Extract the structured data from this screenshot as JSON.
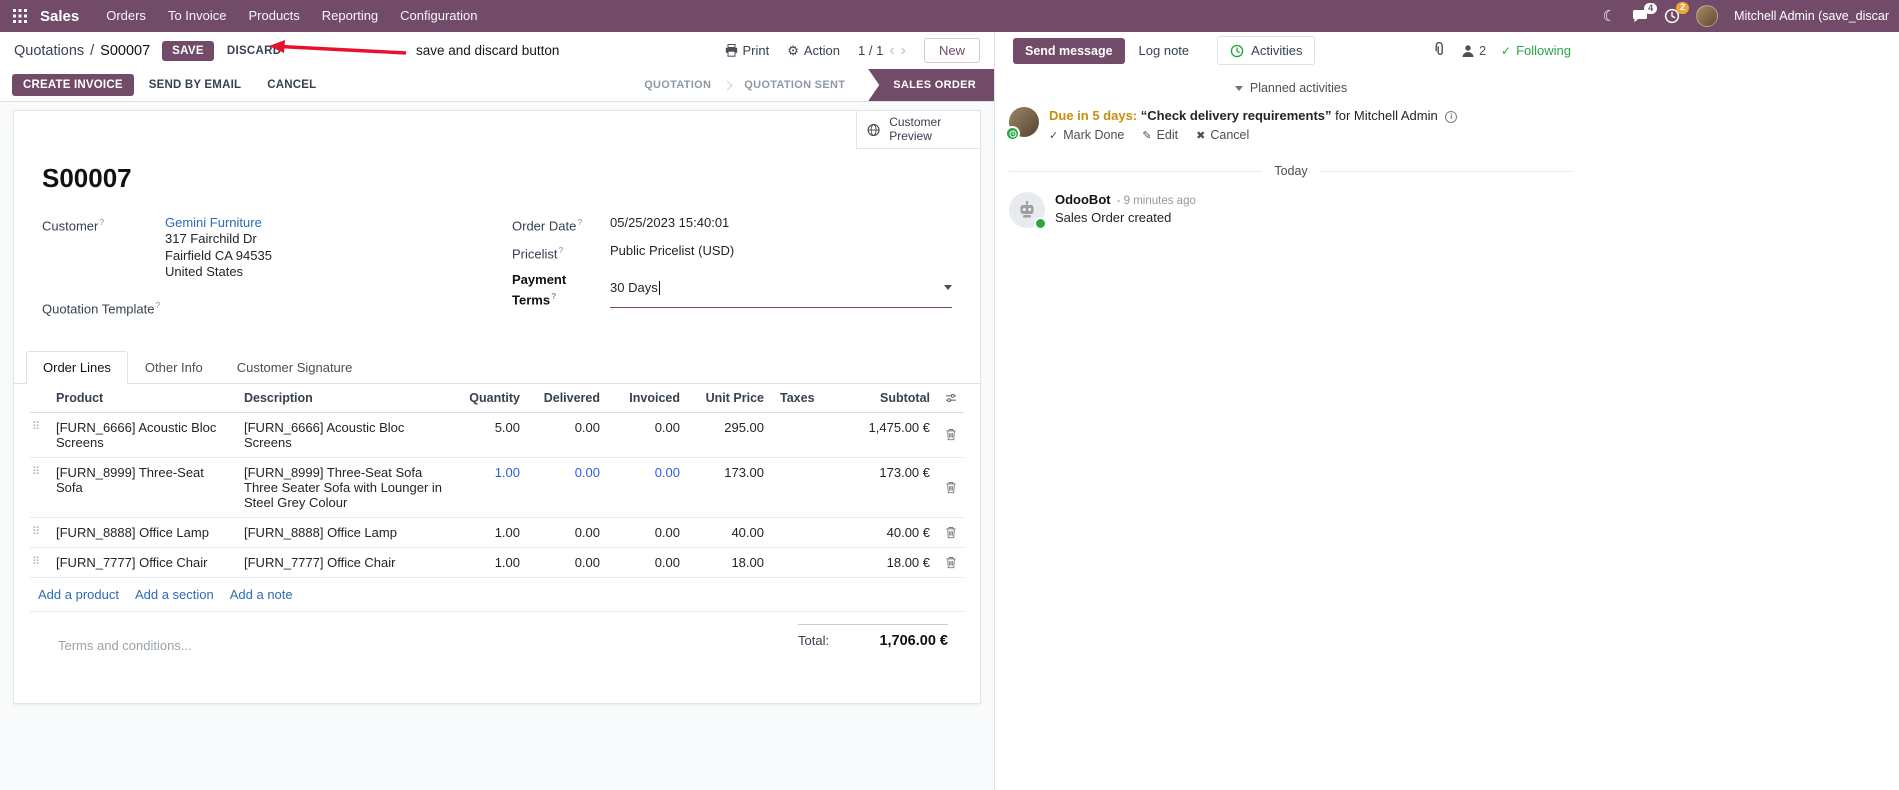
{
  "topbar": {
    "brand": "Sales",
    "menus": [
      "Orders",
      "To Invoice",
      "Products",
      "Reporting",
      "Configuration"
    ],
    "message_badge": "4",
    "activity_badge": "2",
    "user_name": "Mitchell Admin (save_discar"
  },
  "control_panel": {
    "breadcrumb_parent": "Quotations",
    "breadcrumb_separator": "/",
    "breadcrumb_current": "S00007",
    "save_label": "SAVE",
    "discard_label": "DISCARD",
    "annotation_text": "save and discard button",
    "print_label": "Print",
    "action_label": "Action",
    "pager": "1 / 1",
    "new_label": "New"
  },
  "status_row": {
    "create_invoice": "CREATE INVOICE",
    "send_by_email": "SEND BY EMAIL",
    "cancel": "CANCEL",
    "states": [
      {
        "label": "QUOTATION"
      },
      {
        "label": "QUOTATION SENT"
      },
      {
        "label": "SALES ORDER"
      }
    ]
  },
  "sheet": {
    "customer_preview": "Customer Preview",
    "title": "S00007",
    "customer": {
      "label": "Customer",
      "name": "Gemini Furniture",
      "address1": "317 Fairchild Dr",
      "address2": "Fairfield CA 94535",
      "address3": "United States"
    },
    "quotation_template_label": "Quotation Template",
    "order_date": {
      "label": "Order Date",
      "value": "05/25/2023 15:40:01"
    },
    "pricelist": {
      "label": "Pricelist",
      "value": "Public Pricelist (USD)"
    },
    "payment_terms": {
      "label": "Payment Terms",
      "value": "30 Days"
    },
    "tabs": [
      "Order Lines",
      "Other Info",
      "Customer Signature"
    ],
    "table": {
      "headers": {
        "product": "Product",
        "description": "Description",
        "quantity": "Quantity",
        "delivered": "Delivered",
        "invoiced": "Invoiced",
        "unit_price": "Unit Price",
        "taxes": "Taxes",
        "subtotal": "Subtotal"
      },
      "rows": [
        {
          "product": "[FURN_6666] Acoustic Bloc Screens",
          "description": "[FURN_6666] Acoustic Bloc Screens",
          "description2": "",
          "quantity": "5.00",
          "delivered": "0.00",
          "invoiced": "0.00",
          "unit_price": "295.00",
          "taxes": "",
          "subtotal": "1,475.00 €"
        },
        {
          "product": "[FURN_8999] Three-Seat Sofa",
          "description": "[FURN_8999] Three-Seat Sofa",
          "description2": "Three Seater Sofa with Lounger in Steel Grey Colour",
          "quantity": "1.00",
          "delivered": "0.00",
          "invoiced": "0.00",
          "unit_price": "173.00",
          "taxes": "",
          "subtotal": "173.00 €"
        },
        {
          "product": "[FURN_8888] Office Lamp",
          "description": "[FURN_8888] Office Lamp",
          "description2": "",
          "quantity": "1.00",
          "delivered": "0.00",
          "invoiced": "0.00",
          "unit_price": "40.00",
          "taxes": "",
          "subtotal": "40.00 €"
        },
        {
          "product": "[FURN_7777] Office Chair",
          "description": "[FURN_7777] Office Chair",
          "description2": "",
          "quantity": "1.00",
          "delivered": "0.00",
          "invoiced": "0.00",
          "unit_price": "18.00",
          "taxes": "",
          "subtotal": "18.00 €"
        }
      ],
      "add_product": "Add a product",
      "add_section": "Add a section",
      "add_note": "Add a note"
    },
    "terms_placeholder": "Terms and conditions...",
    "total_label": "Total:",
    "total_value": "1,706.00 €"
  },
  "chatter": {
    "send_message": "Send message",
    "log_note": "Log note",
    "activities": "Activities",
    "followers_count": "2",
    "following": "Following",
    "planned_activities": "Planned activities",
    "activity": {
      "due": "Due in 5 days:",
      "summary": "“Check delivery requirements”",
      "assignee": "for Mitchell Admin",
      "mark_done": "Mark Done",
      "edit": "Edit",
      "cancel": "Cancel"
    },
    "date_divider": "Today",
    "message": {
      "author": "OdooBot",
      "time": "- 9 minutes ago",
      "body": "Sales Order created"
    }
  },
  "icons": {
    "moon": "☾",
    "gear": "⚙",
    "chevron_left": "‹",
    "chevron_right": "›",
    "drag": "⠿",
    "check": "✓",
    "edit": "✎",
    "cancel": "✖"
  },
  "colors": {
    "brand": "#714B67",
    "link": "#2b6cb8",
    "edited": "#2d5be0",
    "success": "#28a745",
    "warning_due": "#c98e0a",
    "annotation": "#e8112d"
  }
}
